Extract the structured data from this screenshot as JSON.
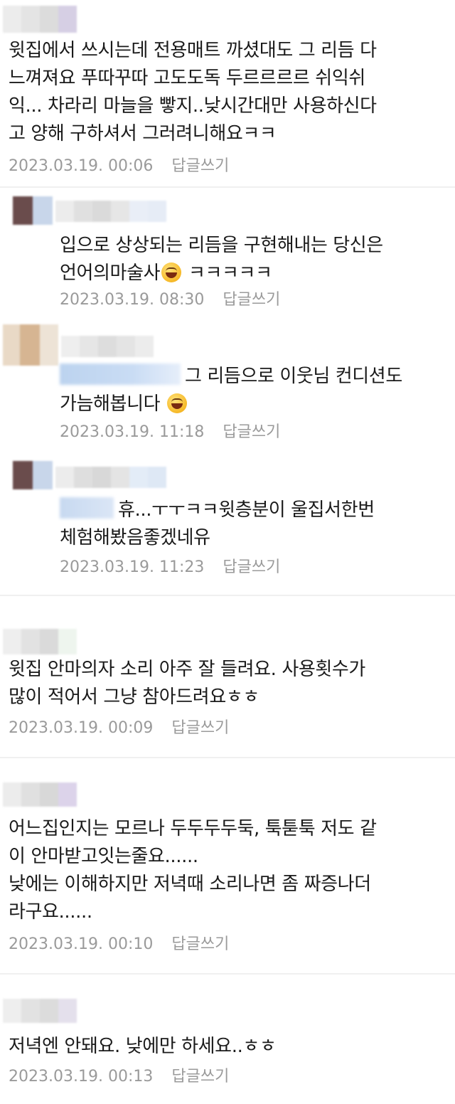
{
  "colors": {
    "meta_text": "#9a9a9a",
    "divider": "#f0f0f0",
    "mention_blur": "#c9dcf4"
  },
  "reply_label": "답글쓰기",
  "comments": [
    {
      "text": "윗집에서 쓰시는데 전용매트 까셨대도 그 리듬 다\n느껴져요 푸따꾸따 고도도독 두르르르르 쉬익쉬\n익... 차라리 마늘을 빻지..낮시간대만 사용하신다\n고 양해 구하셔서 그러려니해요ㅋㅋ",
      "date": "2023.03.19. 00:06"
    },
    {
      "text_before_emoji": "입으로 상상되는 리듬을 구현해내는 당신은\n언어의마술사",
      "emoji": "rofl-emoji",
      "text_after_emoji": " ㅋㅋㅋㅋㅋ",
      "date": "2023.03.19. 08:30"
    },
    {
      "text_line1": "그 리듬으로 이웃님 컨디션도",
      "text_line2": "가늠해봅니다 ",
      "emoji": "grinning-emoji",
      "date": "2023.03.19. 11:18"
    },
    {
      "text_line1": "휴...ㅜㅜㅋㅋ윗층분이 울집서한번",
      "text_line2": "체험해봤음좋겠네유",
      "date": "2023.03.19. 11:23"
    },
    {
      "text": "윗집 안마의자 소리 아주 잘 들려요. 사용횟수가\n많이 적어서 그냥 참아드려요ㅎㅎ",
      "date": "2023.03.19. 00:09"
    },
    {
      "text": "어느집인지는 모르나 두두두두둑, 툭툳툭 저도 같\n이 안마받고잇는줄요......\n낮에는 이해하지만 저녁때 소리나면 좀 짜증나더\n라구요......",
      "date": "2023.03.19. 00:10"
    },
    {
      "text": "저녁엔 안돼요. 낮에만 하세요..ㅎㅎ",
      "date": "2023.03.19. 00:13"
    }
  ]
}
